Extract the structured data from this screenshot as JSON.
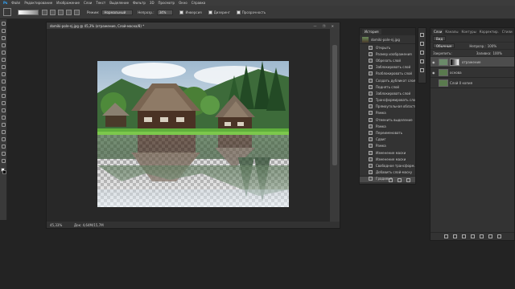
{
  "menu": [
    "Файл",
    "Редактирование",
    "Изображение",
    "Слои",
    "Текст",
    "Выделение",
    "Фильтр",
    "3D",
    "Просмотр",
    "Окно",
    "Справка"
  ],
  "options": {
    "mode_label": "Режим:",
    "mode_value": "Нормальный",
    "opacity_label": "Непрозр.:",
    "opacity_value": "34%",
    "checkbox1": "Инверсия",
    "checkbox2": "Дизеринг",
    "checkbox3": "Прозрачность"
  },
  "document": {
    "tab_title": "domiki-pole-nj.jpg @ 45,3% (отражение, Слой-маска/8) *",
    "window_controls": "— ❐ ✕",
    "zoom": "45,33%",
    "doc_info": "Док: 4,64М/15,7М"
  },
  "history": {
    "tab": "История",
    "snapshot": "domiki-pole-nj.jpg",
    "items": [
      "Открыть",
      "Размер изображения",
      "Обрезать слой",
      "Заблокировать слой",
      "Разблокировать слой",
      "Создать дубликат слоя",
      "Поднять слой",
      "Заблокировать слой",
      "Трансформировать слой",
      "Прямоугольная область",
      "Рамка",
      "Отменить выделение",
      "Рамка",
      "Переименовать",
      "Сдвиг",
      "Рамка",
      "Изменение маски",
      "Изменение маски",
      "Свободное трансформ...",
      "Добавить слой-маску",
      "Градиент"
    ]
  },
  "layers": {
    "tabs": [
      "Слои",
      "Каналы",
      "Контуры",
      "Корректир.",
      "Стили"
    ],
    "kind_label": "Вид",
    "blend": "Обычные",
    "opacity_label": "Непрозр.:",
    "opacity_value": "100%",
    "lock_label": "Закрепить:",
    "fill_label": "Заливка:",
    "fill_value": "100%",
    "rows": [
      {
        "name": "отражение",
        "selected": true,
        "mask": true
      },
      {
        "name": "основа",
        "selected": false,
        "mask": false
      },
      {
        "name": "Слой 0 копия",
        "selected": false,
        "mask": false
      }
    ]
  },
  "colors": {
    "accent_selected": "#4d4d4d",
    "panel": "#333333",
    "workspace": "#232323"
  }
}
